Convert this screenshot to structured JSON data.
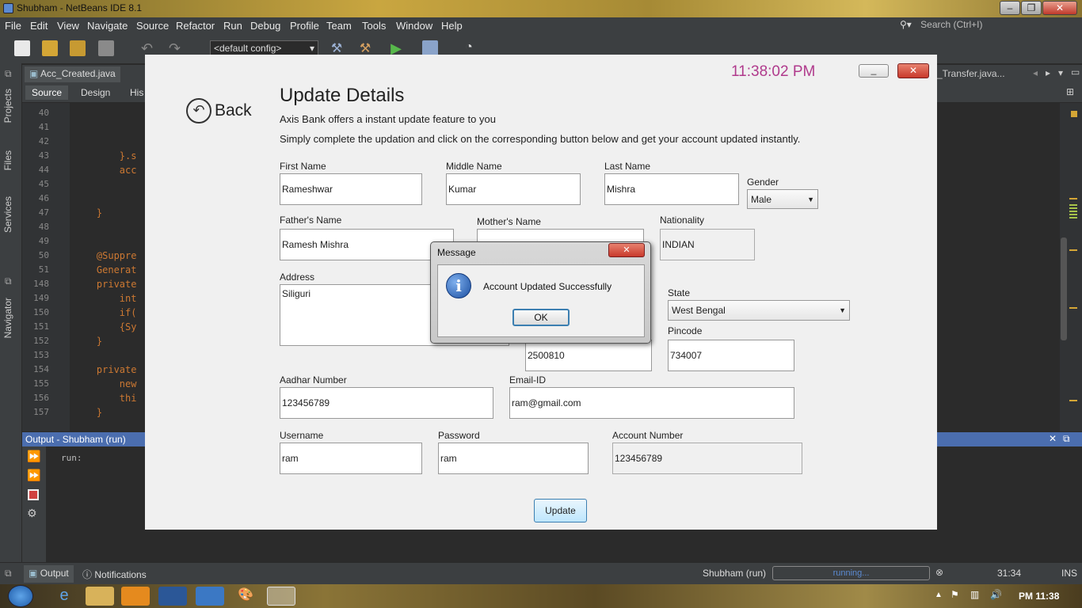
{
  "window": {
    "title": "Shubham - NetBeans IDE 8.1"
  },
  "menu": [
    "File",
    "Edit",
    "View",
    "Navigate",
    "Source",
    "Refactor",
    "Run",
    "Debug",
    "Profile",
    "Team",
    "Tools",
    "Window",
    "Help"
  ],
  "search": {
    "placeholder": "Search (Ctrl+I)"
  },
  "toolbar": {
    "config": "<default config>"
  },
  "side_tabs": {
    "projects": "Projects",
    "files": "Files",
    "services": "Services",
    "navigator": "Navigator"
  },
  "editor": {
    "tab1": "Acc_Created.java",
    "tab_right": "_Transfer.java...",
    "source_tab": "Source",
    "design_tab": "Design",
    "history_tab": "His",
    "lines": [
      {
        "n": "40",
        "code": ""
      },
      {
        "n": "41",
        "code": ""
      },
      {
        "n": "42",
        "code": ""
      },
      {
        "n": "43",
        "code": "        }.s"
      },
      {
        "n": "44",
        "code": "        acc"
      },
      {
        "n": "45",
        "code": ""
      },
      {
        "n": "46",
        "code": ""
      },
      {
        "n": "47",
        "code": "    }"
      },
      {
        "n": "48",
        "code": ""
      },
      {
        "n": "49",
        "code": ""
      },
      {
        "n": "50",
        "code": "    @Suppre"
      },
      {
        "n": "51",
        "code": "    Generat"
      },
      {
        "n": "148",
        "code": "    private"
      },
      {
        "n": "149",
        "code": "        int"
      },
      {
        "n": "150",
        "code": "        if("
      },
      {
        "n": "151",
        "code": "        {Sy"
      },
      {
        "n": "152",
        "code": "    }"
      },
      {
        "n": "153",
        "code": ""
      },
      {
        "n": "154",
        "code": "    private"
      },
      {
        "n": "155",
        "code": "        new"
      },
      {
        "n": "156",
        "code": "        thi"
      },
      {
        "n": "157",
        "code": "    }"
      }
    ]
  },
  "output": {
    "header": "Output - Shubham (run)",
    "text": "run:"
  },
  "statusbar": {
    "output_tab": "Output",
    "notifications_tab": "Notifications",
    "task": "Shubham (run)",
    "progress_text": "running...",
    "position": "31:34",
    "mode": "INS"
  },
  "taskbar": {
    "clock": "PM 11:38"
  },
  "form": {
    "clock": "11:38:02 PM",
    "back": "Back",
    "heading": "Update Details",
    "sub1": "Axis Bank offers a instant update feature to you",
    "sub2": "Simply complete the updation and click on the corresponding button below and get your account updated instantly.",
    "first_name_label": "First Name",
    "first_name": "Rameshwar",
    "middle_name_label": "Middle Name",
    "middle_name": "Kumar",
    "last_name_label": "Last Name",
    "last_name": "Mishra",
    "gender_label": "Gender",
    "gender": "Male",
    "father_label": "Father's Name",
    "father": "Ramesh Mishra",
    "mother_label": "Mother's Name",
    "nationality_label": "Nationality",
    "nationality": "INDIAN",
    "address_label": "Address",
    "address": "Siliguri",
    "state_label": "State",
    "state": "West Bengal",
    "phone": "2500810",
    "pincode_label": "Pincode",
    "pincode": "734007",
    "aadhar_label": "Aadhar Number",
    "aadhar": "123456789",
    "email_label": "Email-ID",
    "email": "ram@gmail.com",
    "username_label": "Username",
    "username": "ram",
    "password_label": "Password",
    "password": "ram",
    "account_label": "Account Number",
    "account": "123456789",
    "update_button": "Update",
    "minimize": "_",
    "close": "✕"
  },
  "message": {
    "title": "Message",
    "text": "Account Updated Successfully",
    "ok": "OK",
    "icon": "info-icon"
  },
  "colors": {
    "clock": "#b03a8c",
    "accent": "#4b6eaf",
    "close_red": "#c8392b"
  }
}
